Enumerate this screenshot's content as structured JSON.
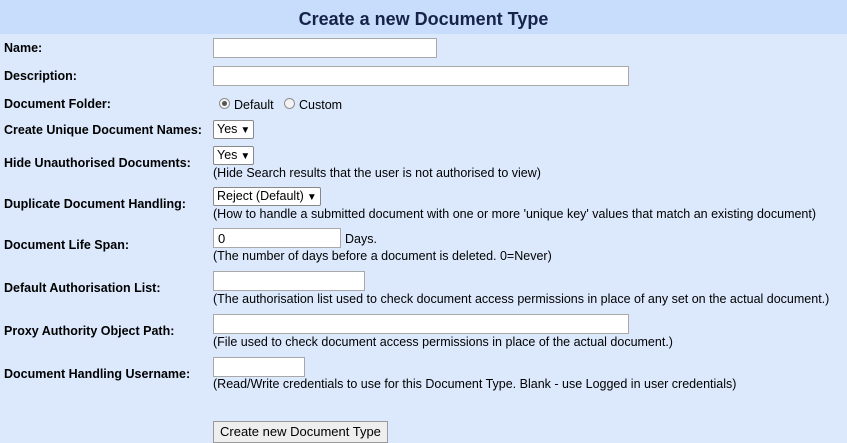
{
  "title": "Create a new Document Type",
  "fields": {
    "name": {
      "label": "Name:",
      "value": ""
    },
    "description": {
      "label": "Description:",
      "value": ""
    },
    "folder": {
      "label": "Document Folder:",
      "options": [
        "Default",
        "Custom"
      ],
      "selected": "Default"
    },
    "unique_names": {
      "label": "Create Unique Document Names:",
      "value": "Yes"
    },
    "hide_unauth": {
      "label": "Hide Unauthorised Documents:",
      "value": "Yes",
      "hint": "(Hide Search results that the user is not authorised to view)"
    },
    "duplicate": {
      "label": "Duplicate Document Handling:",
      "value": "Reject (Default)",
      "hint": "(How to handle a submitted document with one or more 'unique key' values that match an existing document)"
    },
    "life_span": {
      "label": "Document Life Span:",
      "value": "0",
      "unit": "Days.",
      "hint": "(The number of days before a document is deleted. 0=Never)"
    },
    "auth_list": {
      "label": "Default Authorisation List:",
      "value": "",
      "hint": "(The authorisation list used to check document access permissions in place of any set on the actual document.)"
    },
    "proxy_path": {
      "label": "Proxy Authority Object Path:",
      "value": "",
      "hint": "(File used to check document access permissions in place of the actual document.)"
    },
    "username": {
      "label": "Document Handling Username:",
      "value": "",
      "hint": "(Read/Write credentials to use for this Document Type. Blank - use Logged in user credentials)"
    }
  },
  "submit_label": "Create new Document Type",
  "dropdown_arrow": "▼"
}
